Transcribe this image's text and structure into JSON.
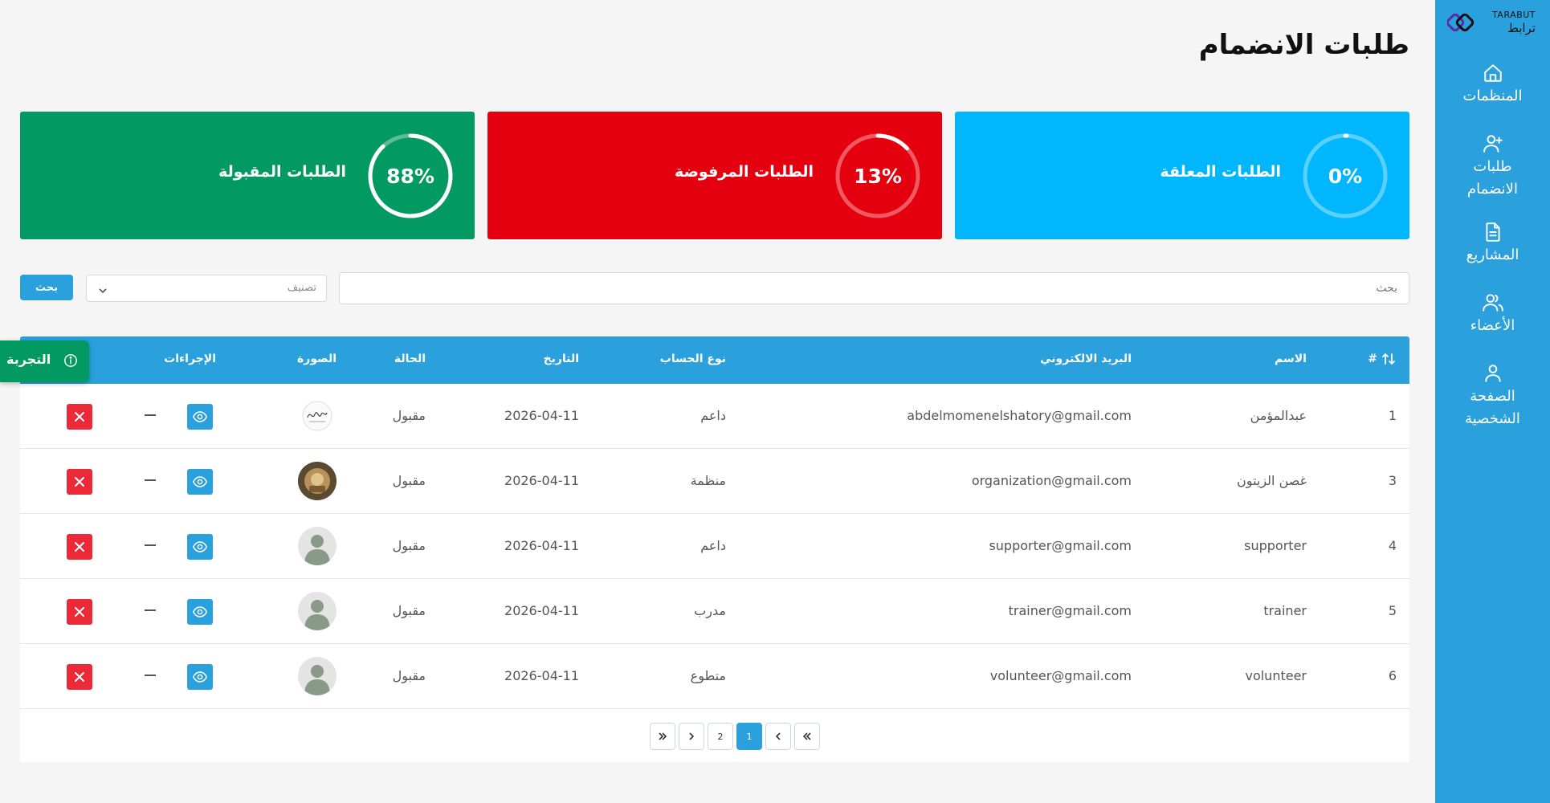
{
  "brand": {
    "name_en": "TARABUT",
    "name_ar": "ترابط"
  },
  "sidebar": {
    "items": [
      {
        "label": "المنظمات",
        "icon": "home-icon"
      },
      {
        "label": "طلبات الانضمام",
        "icon": "user-plus-icon"
      },
      {
        "label": "المشاريع",
        "icon": "document-icon"
      },
      {
        "label": "الأعضاء",
        "icon": "users-icon"
      },
      {
        "label": "الصفحة الشخصية",
        "icon": "user-icon"
      }
    ]
  },
  "page": {
    "title": "طلبات الانضمام"
  },
  "stats": [
    {
      "label": "الطلبات المعلقة",
      "percent_text": "0%",
      "percent": 0,
      "color": "#00b7fe"
    },
    {
      "label": "الطلبات المرفوضة",
      "percent_text": "13%",
      "percent": 13,
      "color": "#e5000f"
    },
    {
      "label": "الطلبات المقبولة",
      "percent_text": "88%",
      "percent": 88,
      "color": "#039962"
    }
  ],
  "search": {
    "placeholder": "بحث",
    "filter_placeholder": "تصنيف",
    "button_label": "بحث"
  },
  "table": {
    "headers": {
      "index": "#",
      "name": "الاسم",
      "email": "البريد الالكتروني",
      "account_type": "نوع الحساب",
      "date": "التاريخ",
      "status": "الحالة",
      "image": "الصورة",
      "actions": "الإجراءات"
    },
    "rows": [
      {
        "index": "1",
        "name": "عبدالمؤمن",
        "email": "abdelmomenelshatory@gmail.com",
        "account_type": "داعم",
        "date": "2026-04-11",
        "status": "مقبول",
        "avatar": "signature"
      },
      {
        "index": "3",
        "name": "غصن الزيتون",
        "email": "organization@gmail.com",
        "account_type": "منظمة",
        "date": "2026-04-11",
        "status": "مقبول",
        "avatar": "photo"
      },
      {
        "index": "4",
        "name": "supporter",
        "email": "supporter@gmail.com",
        "account_type": "داعم",
        "date": "2026-04-11",
        "status": "مقبول",
        "avatar": "default"
      },
      {
        "index": "5",
        "name": "trainer",
        "email": "trainer@gmail.com",
        "account_type": "مدرب",
        "date": "2026-04-11",
        "status": "مقبول",
        "avatar": "default"
      },
      {
        "index": "6",
        "name": "volunteer",
        "email": "volunteer@gmail.com",
        "account_type": "متطوع",
        "date": "2026-04-11",
        "status": "مقبول",
        "avatar": "default"
      }
    ]
  },
  "pagination": {
    "pages": [
      "2",
      "1"
    ],
    "current": "1"
  },
  "trial": {
    "label": "التجربة"
  },
  "colors": {
    "primary": "#2aa0dc",
    "danger": "#ec2a37",
    "success": "#039962"
  }
}
